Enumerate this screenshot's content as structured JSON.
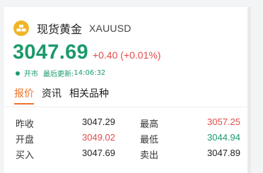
{
  "instrument": {
    "name": "现货黄金",
    "code": "XAUUSD",
    "logo_icon": "gold-bars-icon",
    "logo_color": "#f0b429"
  },
  "price": {
    "last": "3047.69",
    "change": "+0.40",
    "change_pct": "(+0.01%)",
    "price_color": "#1a9a6a",
    "change_color": "#e34a4a"
  },
  "status": {
    "state": "开市",
    "update_label": "最后更新:",
    "update_time": "14:06:32"
  },
  "tabs": [
    {
      "label": "报价",
      "active": true
    },
    {
      "label": "资讯",
      "active": false
    },
    {
      "label": "相关品种",
      "active": false
    }
  ],
  "quotes": [
    {
      "label1": "昨收",
      "value1": "3047.29",
      "dir1": "neutral",
      "label2": "最高",
      "value2": "3057.25",
      "dir2": "up"
    },
    {
      "label1": "开盘",
      "value1": "3049.02",
      "dir1": "up",
      "label2": "最低",
      "value2": "3044.94",
      "dir2": "down"
    },
    {
      "label1": "买入",
      "value1": "3047.69",
      "dir1": "neutral",
      "label2": "卖出",
      "value2": "3047.89",
      "dir2": "neutral"
    }
  ],
  "colors": {
    "accent": "#e8742a",
    "up": "#e34a4a",
    "down": "#1a9a6a"
  }
}
